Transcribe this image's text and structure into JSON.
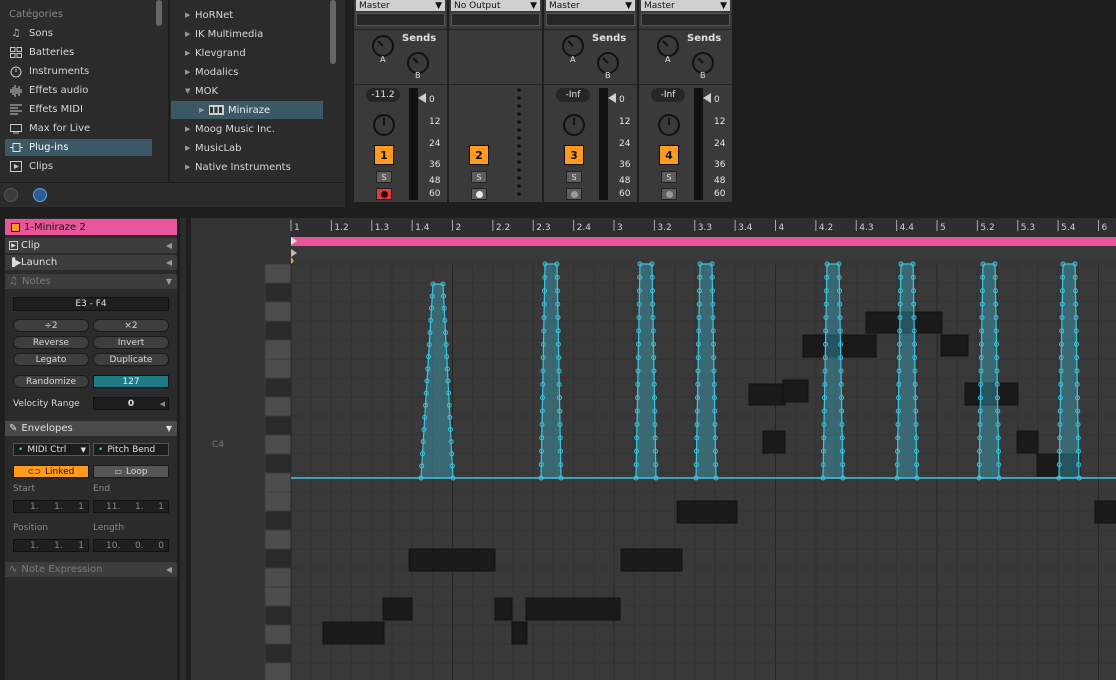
{
  "browser": {
    "categories_header": "Catégories",
    "categories": [
      {
        "label": "Sons",
        "icon": "music-note-icon",
        "selected": false
      },
      {
        "label": "Batteries",
        "icon": "drum-grid-icon",
        "selected": false
      },
      {
        "label": "Instruments",
        "icon": "clock-icon",
        "selected": false
      },
      {
        "label": "Effets audio",
        "icon": "waveform-icon",
        "selected": false
      },
      {
        "label": "Effets MIDI",
        "icon": "midi-lines-icon",
        "selected": false
      },
      {
        "label": "Max for Live",
        "icon": "max-device-icon",
        "selected": false
      },
      {
        "label": "Plug-ins",
        "icon": "plugin-icon",
        "selected": true
      },
      {
        "label": "Clips",
        "icon": "clip-icon",
        "selected": false
      }
    ],
    "folders": [
      {
        "label": "HoRNet",
        "expanded": false,
        "selected": false
      },
      {
        "label": "IK Multimedia",
        "expanded": false,
        "selected": false
      },
      {
        "label": "Klevgrand",
        "expanded": false,
        "selected": false
      },
      {
        "label": "Modalics",
        "expanded": false,
        "selected": false
      },
      {
        "label": "MOK",
        "expanded": true,
        "selected": false
      },
      {
        "label": "Miniraze",
        "expanded": false,
        "selected": true,
        "child": true
      },
      {
        "label": "Moog Music Inc.",
        "expanded": false,
        "selected": false
      },
      {
        "label": "MusicLab",
        "expanded": false,
        "selected": false
      },
      {
        "label": "Native Instruments",
        "expanded": false,
        "selected": false
      }
    ]
  },
  "mixer": {
    "strips": [
      {
        "route": "Master",
        "sends": true,
        "sends_label": "Sends",
        "volume": "-11.2",
        "number": "1",
        "solo": "S",
        "has_meter": true,
        "arm": "record"
      },
      {
        "route": "No Output",
        "sends": false,
        "sends_label": "",
        "volume": "",
        "number": "2",
        "solo": "S",
        "has_meter": false,
        "arm": "record"
      },
      {
        "route": "Master",
        "sends": true,
        "sends_label": "Sends",
        "volume": "-Inf",
        "number": "3",
        "solo": "S",
        "has_meter": true,
        "arm": "dot"
      },
      {
        "route": "Master",
        "sends": true,
        "sends_label": "Sends",
        "volume": "-Inf",
        "number": "4",
        "solo": "S",
        "has_meter": true,
        "arm": "dot"
      }
    ],
    "knob_a": "A",
    "knob_b": "B",
    "db_scale": [
      "0",
      "12",
      "24",
      "36",
      "48",
      "60"
    ]
  },
  "clip": {
    "name": "1-Miniraze 2",
    "clip_section": "Clip",
    "launch_section": "Launch",
    "notes_section": "Notes",
    "note_range": "E3 - F4",
    "buttons": {
      "half": "÷2",
      "double": "×2",
      "reverse": "Reverse",
      "invert": "Invert",
      "legato": "Legato",
      "duplicate": "Duplicate",
      "randomize": "Randomize"
    },
    "randomize_value": "127",
    "velocity_range_label": "Velocity Range",
    "velocity_range_value": "0",
    "envelopes_section": "Envelopes",
    "env_device": "MIDI Ctrl",
    "env_control": "Pitch Bend",
    "linked": "Linked",
    "loop": "Loop",
    "start_label": "Start",
    "end_label": "End",
    "start_value": [
      "1.",
      "1.",
      "1"
    ],
    "end_value": [
      "11.",
      "1.",
      "1"
    ],
    "position_label": "Position",
    "length_label": "Length",
    "position_value": [
      "1.",
      "1.",
      "1"
    ],
    "length_value": [
      "10.",
      "0.",
      "0"
    ],
    "note_expression": "Note Expression"
  },
  "roll": {
    "ruler": [
      "1",
      "1.2",
      "1.3",
      "1.4",
      "2",
      "2.2",
      "2.3",
      "2.4",
      "3",
      "3.2",
      "3.3",
      "3.4",
      "4",
      "4.2",
      "4.3",
      "4.4",
      "5",
      "5.2",
      "5.3",
      "5.4",
      "6"
    ],
    "c4_label": "C4",
    "colors": {
      "clip": "#e8559a",
      "envelope": "#3cc4e0",
      "note": "#1a1a1a",
      "track_accent": "#ff9b1f"
    }
  }
}
